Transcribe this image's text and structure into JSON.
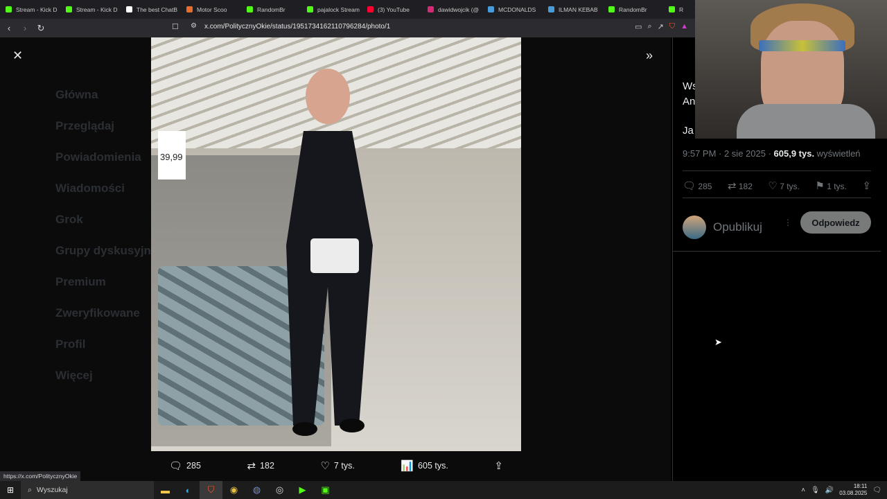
{
  "browser": {
    "tabs": [
      {
        "title": "Stream - Kick D",
        "color": "#53fc18"
      },
      {
        "title": "Stream - Kick D",
        "color": "#53fc18"
      },
      {
        "title": "The best ChatB",
        "color": "#ffffff"
      },
      {
        "title": "Motor Scoo",
        "color": "#e86d2d"
      },
      {
        "title": "RandomBr",
        "color": "#53fc18"
      },
      {
        "title": "pajalock Stream",
        "color": "#53fc18"
      },
      {
        "title": "(3) YouTube",
        "color": "#ff0033"
      },
      {
        "title": "dawidwojcik (@",
        "color": "#d62976"
      },
      {
        "title": "MCDONALDS",
        "color": "#4a9bd9"
      },
      {
        "title": "ILMAN KEBAB",
        "color": "#4a9bd9"
      },
      {
        "title": "RandomBr",
        "color": "#53fc18"
      },
      {
        "title": "R",
        "color": "#53fc18"
      }
    ],
    "url": "x.com/PolitycznyOkie/status/1951734162110796284/photo/1",
    "status_url": "https://x.com/PolitycznyOkie"
  },
  "background_nav": [
    "Główna",
    "Przeglądaj",
    "Powiadomienia",
    "Wiadomości",
    "Grok",
    "Grupy dyskusyjne",
    "Premium",
    "Zweryfikowane",
    "Profil",
    "Więcej"
  ],
  "photo": {
    "price_tag": "39,99"
  },
  "photo_actions": {
    "replies": "285",
    "reposts": "182",
    "likes": "7 tys.",
    "views": "605 tys."
  },
  "post": {
    "text_line1": "Ws",
    "text_line2": "An",
    "text_line3": "Ja",
    "time": "9:57 PM · 2 sie 2025 · ",
    "views": "605,9 tys.",
    "views_label": " wyświetleń",
    "replies": "285",
    "reposts": "182",
    "likes": "7 tys.",
    "bookmarks": "1 tys."
  },
  "reply_box": {
    "placeholder": "Opublikuj",
    "button": "Odpowiedz"
  },
  "taskbar": {
    "search": "Wyszukaj",
    "time": "18:11",
    "date": "03.08.2025"
  }
}
